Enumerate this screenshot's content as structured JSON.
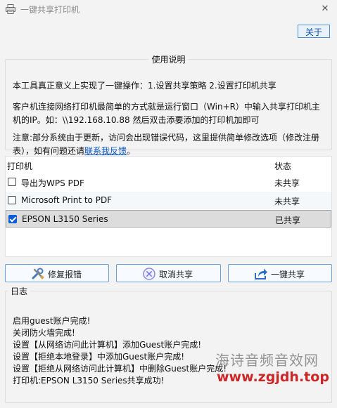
{
  "window": {
    "title": "一键共享打印机",
    "close_glyph": "✕"
  },
  "toolbar": {
    "about_label": "关于"
  },
  "usage": {
    "legend": "使用说明",
    "line1": "本工具真正意义上实现了一键操作：1.设置共享策略 2.设置打印机共享",
    "line2": "客户机连接网络打印机最简单的方式就是运行窗口（Win+R）中输入共享打印机主机的IP。如：\\\\192.168.10.88 然后双击添要添加的打印机加即可",
    "line3_prefix": "注意:部分系统由于更新，访问会出现错误代码，这里提供简单修改选项（修改注册表），如有问题还请",
    "line3_link": "联系我反馈",
    "line3_suffix": "。"
  },
  "printers": {
    "col_name": "打印机",
    "col_status": "状态",
    "rows": [
      {
        "name": "导出为WPS PDF",
        "status": "未共享",
        "checked": false
      },
      {
        "name": "Microsoft Print to PDF",
        "status": "未共享",
        "checked": false
      },
      {
        "name": "EPSON L3150 Series",
        "status": "已共享",
        "checked": true
      }
    ]
  },
  "actions": {
    "repair_label": "修复报错",
    "cancel_label": "取消共享",
    "share_label": "一键共享"
  },
  "log": {
    "legend": "日志",
    "lines": [
      "启用guest账户完成!",
      "关闭防火墙完成!",
      "设置【从网络访问此计算机】添加Guest账户完成!",
      "设置【拒绝本地登录】中添加Guest账户完成!",
      "设置【拒绝从网络访问此计算机】中删除Guest账户完成!",
      "打印机:EPSON L3150 Series共享成功!"
    ]
  },
  "watermark": {
    "line1": "海诗音频音效网",
    "line2": "www.zgjdh.top"
  },
  "colors": {
    "accent": "#0b5cd4",
    "link": "#0b57c8",
    "watermark_red": "#c80f0f"
  }
}
